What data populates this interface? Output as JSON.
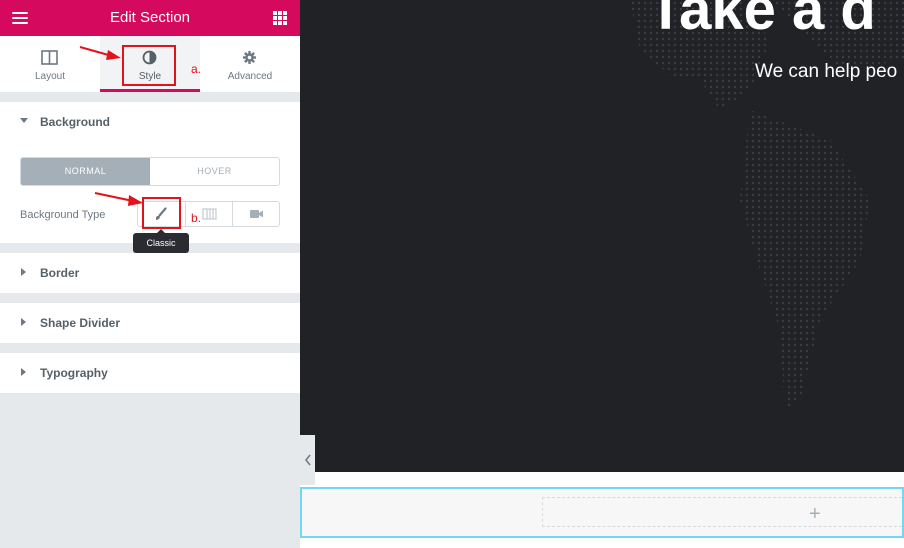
{
  "panel": {
    "title": "Edit Section",
    "tabs": [
      {
        "label": "Layout",
        "icon": "layout-columns-icon"
      },
      {
        "label": "Style",
        "icon": "contrast-half-circle-icon",
        "active": true
      },
      {
        "label": "Advanced",
        "icon": "gear-icon"
      }
    ],
    "background": {
      "heading": "Background",
      "state_tabs": {
        "normal": "NORMAL",
        "hover": "HOVER"
      },
      "type_label": "Background Type",
      "type_options": [
        "brush-icon",
        "gradient-icon",
        "video-camera-icon"
      ],
      "tooltip": "Classic"
    },
    "sections": [
      "Border",
      "Shape Divider",
      "Typography"
    ]
  },
  "annotations": {
    "a": "a.",
    "b": "b."
  },
  "preview": {
    "hero_title": "Take a d",
    "hero_subtitle": "We can help peo",
    "add_label": "+"
  },
  "colors": {
    "accent": "#d5095d",
    "annotation": "#e2141b",
    "hero_bg": "#212226"
  }
}
